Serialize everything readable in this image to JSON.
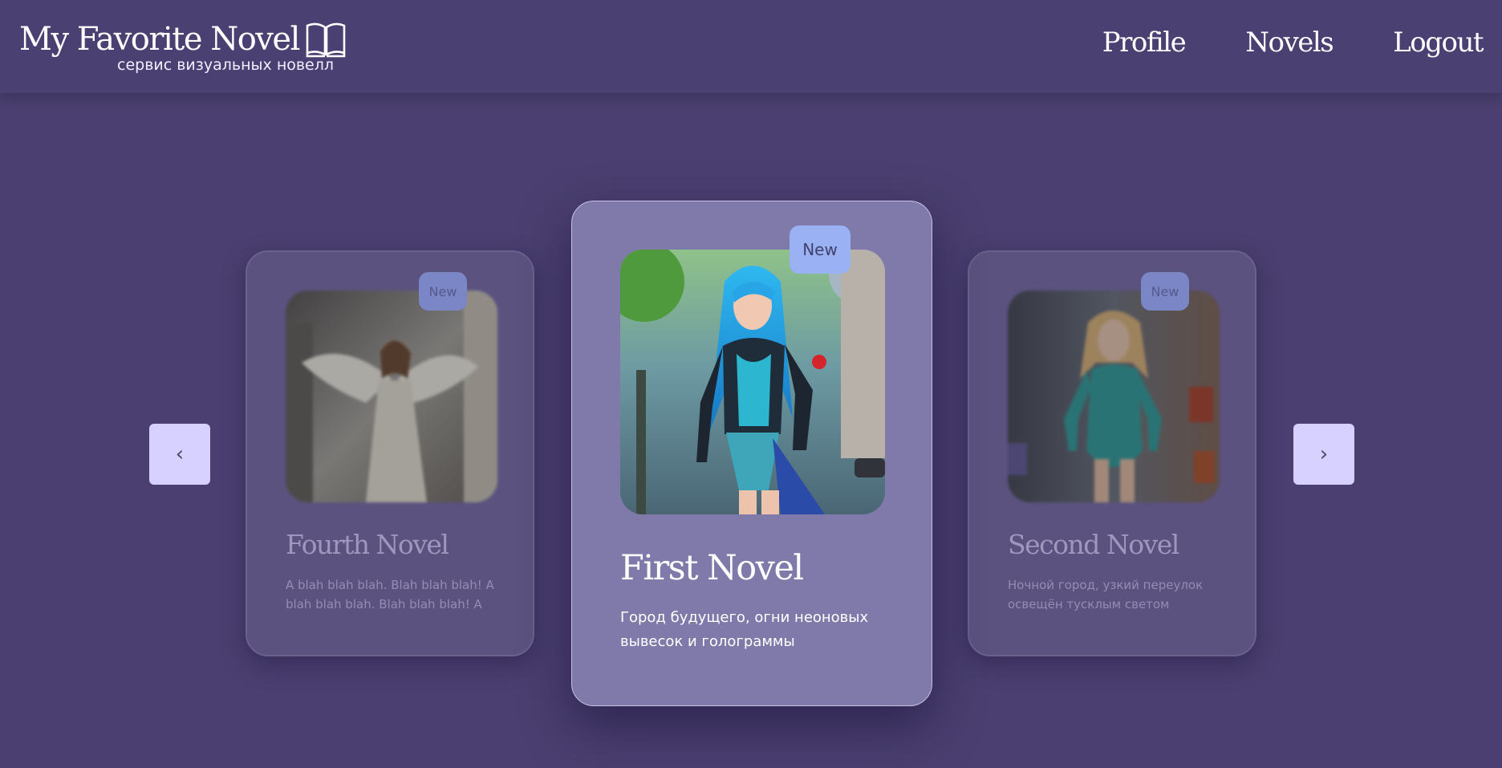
{
  "header": {
    "brand_title": "My Favorite Novel",
    "brand_subtitle": "сервис визуальных новелл",
    "brand_icon": "open-book-icon",
    "nav": [
      {
        "label": "Profile"
      },
      {
        "label": "Novels"
      },
      {
        "label": "Logout"
      }
    ]
  },
  "carousel": {
    "prev_label": "‹",
    "next_label": "›",
    "cards": [
      {
        "badge": "New",
        "title": "Fourth Novel",
        "description": "A blah blah blah. Blah blah blah! A blah blah blah. Blah blah blah! A blah blah...",
        "image": "angel-woman-illustration"
      },
      {
        "badge": "New",
        "title": "First Novel",
        "description": "Город будущего, огни неоновых вывесок и голограммы освещают...",
        "image": "blue-haired-heroine-illustration"
      },
      {
        "badge": "New",
        "title": "Second Novel",
        "description": "Ночной город, узкий переулок освещён тусклым светом уличных...",
        "image": "blonde-teal-suit-heroine-illustration"
      }
    ]
  },
  "colors": {
    "background": "#4a3f70",
    "card_center": "#7f7aaa",
    "badge": "#9ab1f4",
    "arrow_button": "#d6d1ff"
  }
}
